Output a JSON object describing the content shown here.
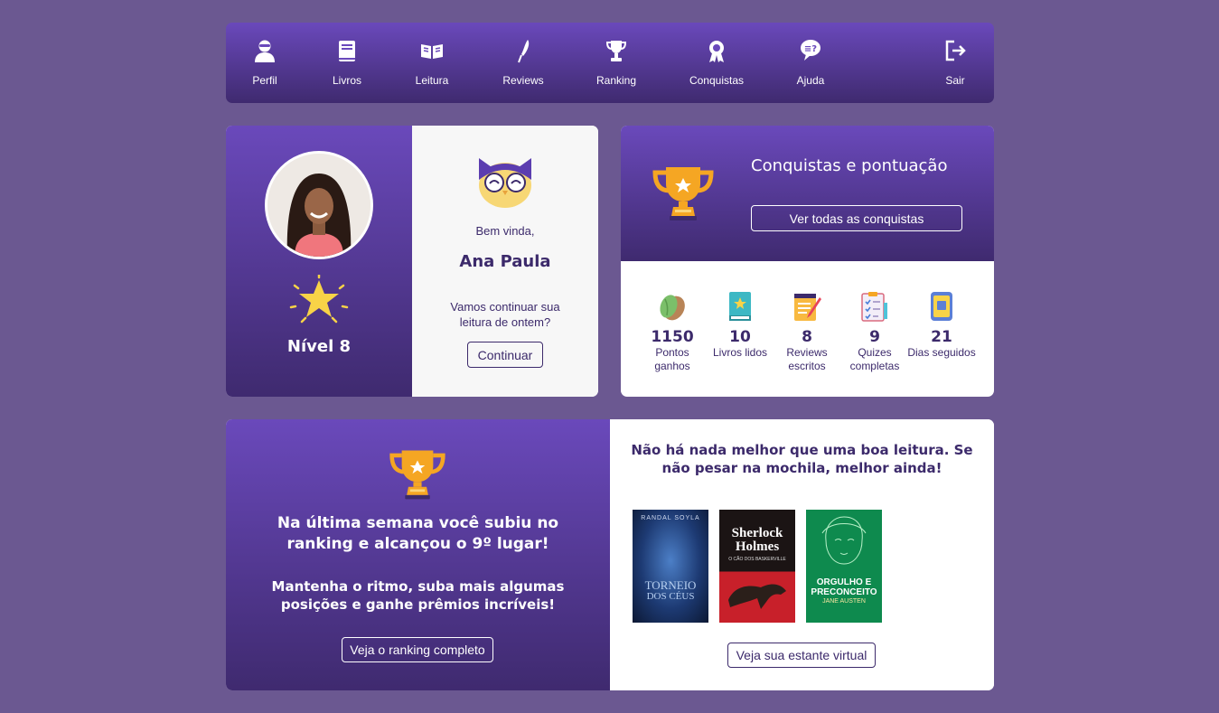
{
  "nav": {
    "items": [
      {
        "label": "Perfil",
        "icon": "user-icon"
      },
      {
        "label": "Livros",
        "icon": "book-icon"
      },
      {
        "label": "Leitura",
        "icon": "open-book-icon"
      },
      {
        "label": "Reviews",
        "icon": "quill-icon"
      },
      {
        "label": "Ranking",
        "icon": "trophy-icon"
      },
      {
        "label": "Conquistas",
        "icon": "medal-icon"
      },
      {
        "label": "Ajuda",
        "icon": "help-chat-icon"
      },
      {
        "label": "Sair",
        "icon": "logout-icon"
      }
    ]
  },
  "profile": {
    "level": "Nível 8",
    "greeting": "Bem vinda,",
    "name": "Ana Paula",
    "prompt": "Vamos continuar sua leitura de ontem?",
    "continue_label": "Continuar"
  },
  "achievements": {
    "title": "Conquistas e pontuação",
    "view_all_label": "Ver todas as conquistas",
    "stats": [
      {
        "value": "1150",
        "label": "Pontos ganhos",
        "icon": "almond-icon"
      },
      {
        "value": "10",
        "label": "Livros lidos",
        "icon": "book-star-icon"
      },
      {
        "value": "8",
        "label": "Reviews escritos",
        "icon": "notepad-pen-icon"
      },
      {
        "value": "9",
        "label": "Quizes completas",
        "icon": "checklist-icon"
      },
      {
        "value": "21",
        "label": "Dias seguidos",
        "icon": "calendar-phone-icon"
      }
    ]
  },
  "ranking": {
    "text": "Na última semana você subiu no ranking e alcançou o 9º lugar!",
    "sub": "Mantenha o ritmo, suba mais algumas posições e ganhe prêmios incríveis!",
    "button_label": "Veja o ranking completo"
  },
  "shelf": {
    "quote": "Não há nada melhor que uma boa leitura. Se não pesar na mochila, melhor ainda!",
    "button_label": "Veja sua estante virtual",
    "books": [
      {
        "title_line1": "TORNEIO",
        "title_line2": "DOS CÉUS",
        "author": "RANDAL SOYLA"
      },
      {
        "title_line1": "Sherlock",
        "title_line2": "Holmes",
        "subtitle": "O CÃO DOS BASKERVILLE"
      },
      {
        "title_line1": "ORGULHO E",
        "title_line2": "PRECONCEITO",
        "author": "JANE AUSTEN"
      }
    ]
  },
  "colors": {
    "purple_dark": "#3c2a6b",
    "purple_grad_top": "#6a49bb",
    "purple_grad_bottom": "#3f2a6f",
    "background": "#6b5891",
    "trophy_gold": "#f5a623"
  }
}
